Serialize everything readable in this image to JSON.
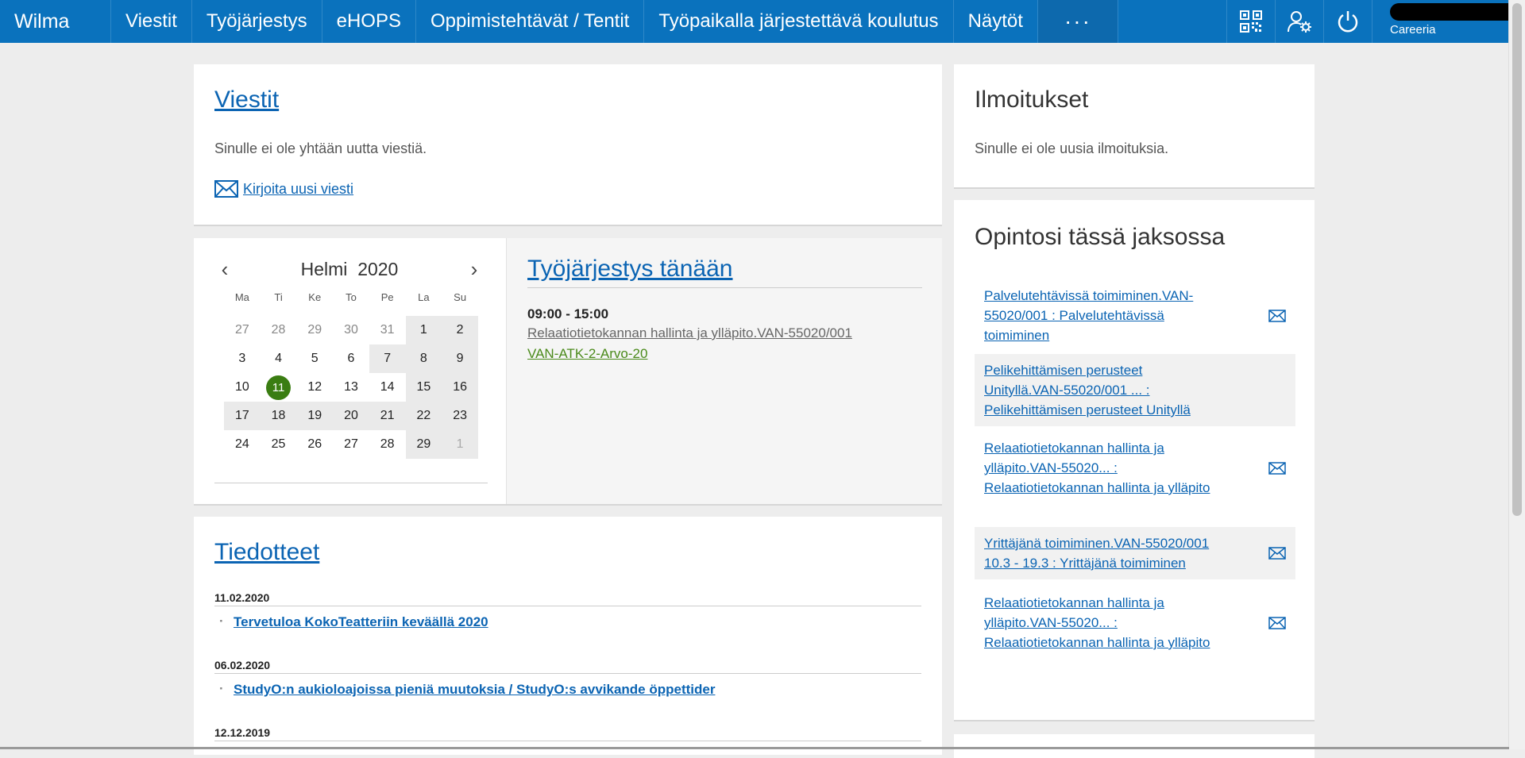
{
  "nav": {
    "brand": "Wilma",
    "items": [
      "Viestit",
      "Työjärjestys",
      "eHOPS",
      "Oppimistehtävät / Tentit",
      "Työpaikalla järjestettävä koulutus",
      "Näytöt"
    ],
    "more": "···",
    "icons": [
      "qr-code-icon",
      "user-settings-icon",
      "power-icon"
    ],
    "org": "Careeria"
  },
  "messages": {
    "title": "Viestit",
    "empty": "Sinulle ei ole yhtään uutta viestiä.",
    "compose": "Kirjoita uusi viesti"
  },
  "notices": {
    "title": "Ilmoitukset",
    "empty": "Sinulle ei ole uusia ilmoituksia."
  },
  "calendar": {
    "month": "Helmi",
    "year": "2020",
    "prev": "‹",
    "next": "›",
    "weekdays": [
      "Ma",
      "Ti",
      "Ke",
      "To",
      "Pe",
      "La",
      "Su"
    ],
    "weeks": [
      [
        "27",
        "28",
        "29",
        "30",
        "31",
        "1",
        "2"
      ],
      [
        "3",
        "4",
        "5",
        "6",
        "7",
        "8",
        "9"
      ],
      [
        "10",
        "11",
        "12",
        "13",
        "14",
        "15",
        "16"
      ],
      [
        "17",
        "18",
        "19",
        "20",
        "21",
        "22",
        "23"
      ],
      [
        "24",
        "25",
        "26",
        "27",
        "28",
        "29",
        "1"
      ]
    ],
    "today": "11"
  },
  "schedule": {
    "title": "Työjärjestys tänään",
    "time": "09:00 - 15:00",
    "course": "Relaatiotietokannan hallinta ja ylläpito.VAN-55020/001",
    "group": "VAN-ATK-2-Arvo-20"
  },
  "bulletins": {
    "title": "Tiedotteet",
    "items": [
      {
        "date": "11.02.2020",
        "title": "Tervetuloa KokoTeatteriin keväällä 2020"
      },
      {
        "date": "06.02.2020",
        "title": "StudyO:n aukioloajoissa pieniä muutoksia / StudyO:s avvikande öppettider"
      },
      {
        "date": "12.12.2019",
        "title": ""
      }
    ]
  },
  "studies": {
    "title": "Opintosi tässä jaksossa",
    "items": [
      {
        "lines": [
          "Palvelutehtävissä toimiminen.VAN-",
          "55020/001 : Palvelutehtävissä",
          "toimiminen  "
        ],
        "mail": true
      },
      {
        "lines": [
          "Pelikehittämisen perusteet",
          "Unityllä.VAN-55020/001 ... :",
          "Pelikehittämisen perusteet Unityllä  "
        ],
        "mail": false
      },
      {
        "lines": [
          "Relaatiotietokannan hallinta ja",
          "ylläpito.VAN-55020... :",
          "Relaatiotietokannan hallinta ja ylläpito",
          " "
        ],
        "mail": true
      },
      {
        "lines": [
          "Yrittäjänä toimiminen.VAN-55020/001",
          "10.3 - 19.3 : Yrittäjänä toimiminen  "
        ],
        "mail": true
      },
      {
        "lines": [
          "Relaatiotietokannan hallinta ja",
          "ylläpito.VAN-55020... :",
          "Relaatiotietokannan hallinta ja ylläpito",
          " "
        ],
        "mail": true
      }
    ]
  }
}
